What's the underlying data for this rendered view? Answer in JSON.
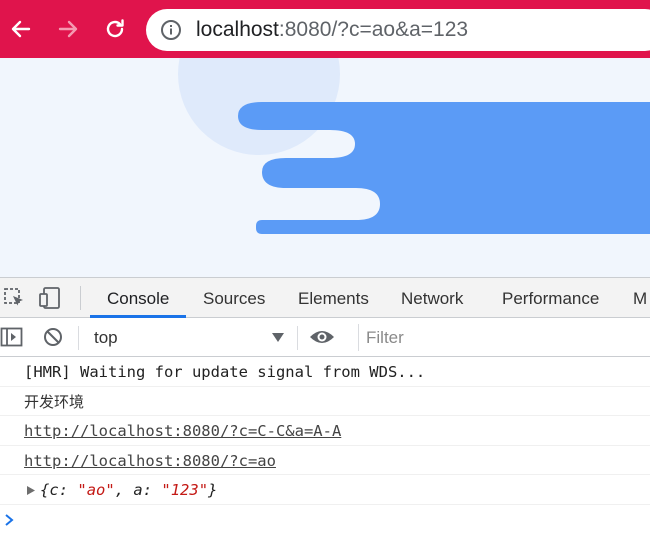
{
  "browser": {
    "url_host": "localhost",
    "url_rest": ":8080/?c=ao&a=123",
    "toolbar_color": "#e0144c",
    "icons": {
      "back": "arrow-left-icon",
      "forward": "arrow-right-icon",
      "reload": "reload-icon",
      "site_info": "info-circle-icon"
    }
  },
  "page": {
    "background": "#f1f6fd",
    "illustration_color": "#5b9bf6"
  },
  "devtools": {
    "tabs": [
      "Console",
      "Sources",
      "Elements",
      "Network",
      "Performance",
      "M"
    ],
    "active_tab": "Console",
    "accent": "#1a73e8",
    "toolbar_icons": [
      "inspect-element-icon",
      "device-toggle-icon"
    ],
    "console_toolbar": {
      "context": "top",
      "filter_placeholder": "Filter",
      "icons": [
        "sidebar-toggle-icon",
        "clear-console-icon",
        "eye-icon"
      ]
    },
    "logs": {
      "hmr": "[HMR] Waiting for update signal from WDS...",
      "env": "开发环境",
      "link1": "http://localhost:8080/?c=C-C&a=A-A",
      "link2": "http://localhost:8080/?c=ao",
      "object": {
        "open": "{",
        "key1": "c",
        "val1": "\"ao\"",
        "key2": "a",
        "val2": "\"123\"",
        "close": "}"
      }
    },
    "prompt_icon": "chevron-right-icon"
  }
}
